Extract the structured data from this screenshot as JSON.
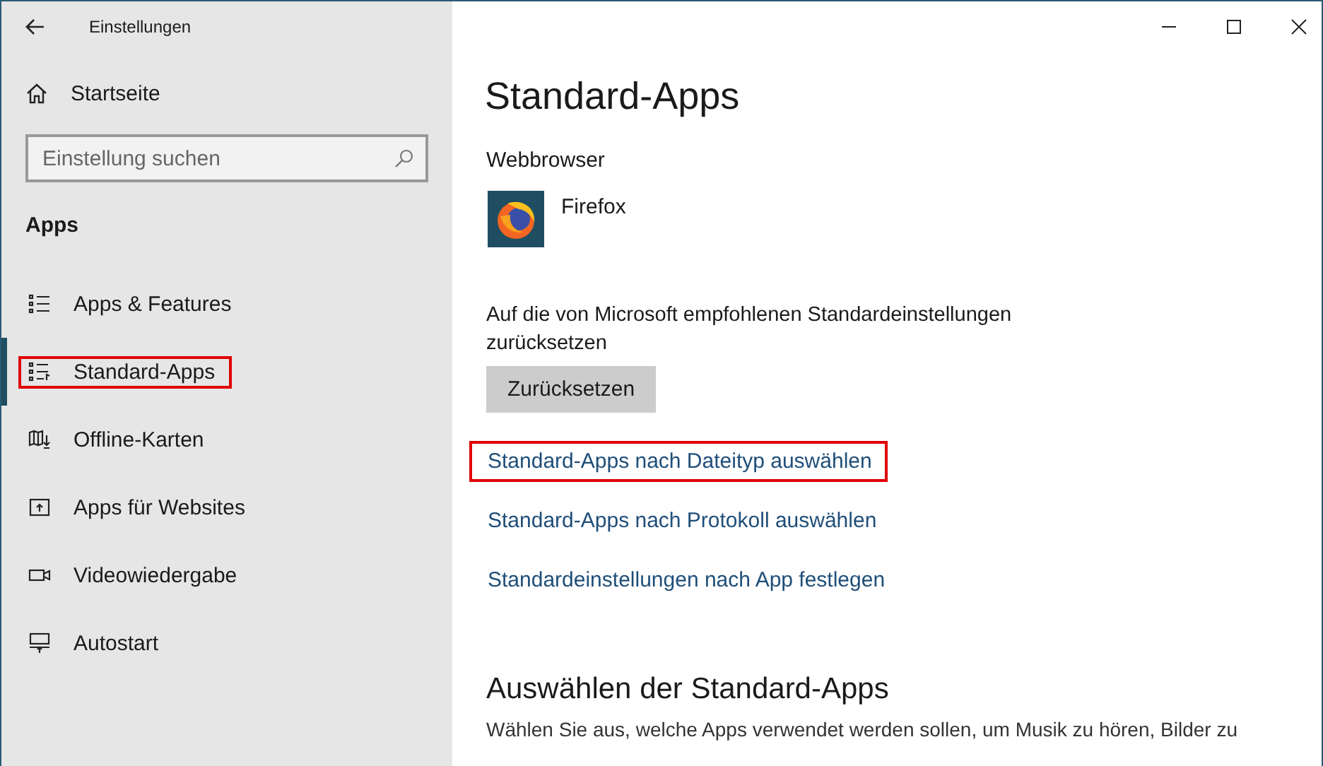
{
  "window": {
    "title": "Einstellungen"
  },
  "sidebar": {
    "home": "Startseite",
    "search": {
      "placeholder": "Einstellung suchen"
    },
    "section": "Apps",
    "items": [
      {
        "label": "Apps & Features",
        "kind": "list",
        "selected": false,
        "highlighted": false
      },
      {
        "label": "Standard-Apps",
        "kind": "defaults",
        "selected": true,
        "highlighted": true
      },
      {
        "label": "Offline-Karten",
        "kind": "map",
        "selected": false,
        "highlighted": false
      },
      {
        "label": "Apps für Websites",
        "kind": "web",
        "selected": false,
        "highlighted": false
      },
      {
        "label": "Videowiedergabe",
        "kind": "video",
        "selected": false,
        "highlighted": false
      },
      {
        "label": "Autostart",
        "kind": "startup",
        "selected": false,
        "highlighted": false
      }
    ]
  },
  "content": {
    "title": "Standard-Apps",
    "browser_label": "Webbrowser",
    "browser_app": "Firefox",
    "reset_text": "Auf die von Microsoft empfohlenen Standardeinstellungen zurücksetzen",
    "reset_button": "Zurücksetzen",
    "links": [
      {
        "label": "Standard-Apps nach Dateityp auswählen",
        "highlighted": true
      },
      {
        "label": "Standard-Apps nach Protokoll auswählen",
        "highlighted": false
      },
      {
        "label": "Standardeinstellungen nach App festlegen",
        "highlighted": false
      }
    ],
    "section_title": "Auswählen der Standard-Apps",
    "section_text": "Wählen Sie aus, welche Apps verwendet werden sollen, um Musik zu hören, Bilder zu"
  }
}
